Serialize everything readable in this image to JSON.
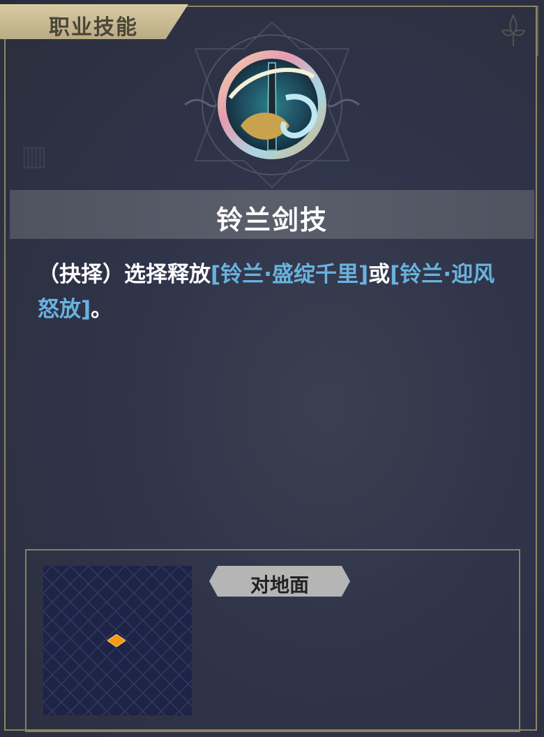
{
  "header": {
    "title": "职业技能"
  },
  "skill": {
    "name": "铃兰剑技",
    "icon": "sword-crescent-emblem-icon",
    "description": {
      "prefix": "（抉择）选择释放",
      "option1": "[铃兰·盛绽千里]",
      "middle": "或",
      "option2": "[铃兰·迎风怒放]",
      "suffix": "。"
    }
  },
  "range": {
    "target_type": "对地面",
    "marker_icon": "orange-diamond-marker-icon"
  },
  "colors": {
    "background": "#2e3241",
    "frame_gold": "#8f8466",
    "title_tab": "#d8cba3",
    "highlight_blue": "#69b3df",
    "grid_bg": "#1e2446",
    "marker_orange": "#f59a14",
    "target_tag": "#b5b5b5"
  }
}
